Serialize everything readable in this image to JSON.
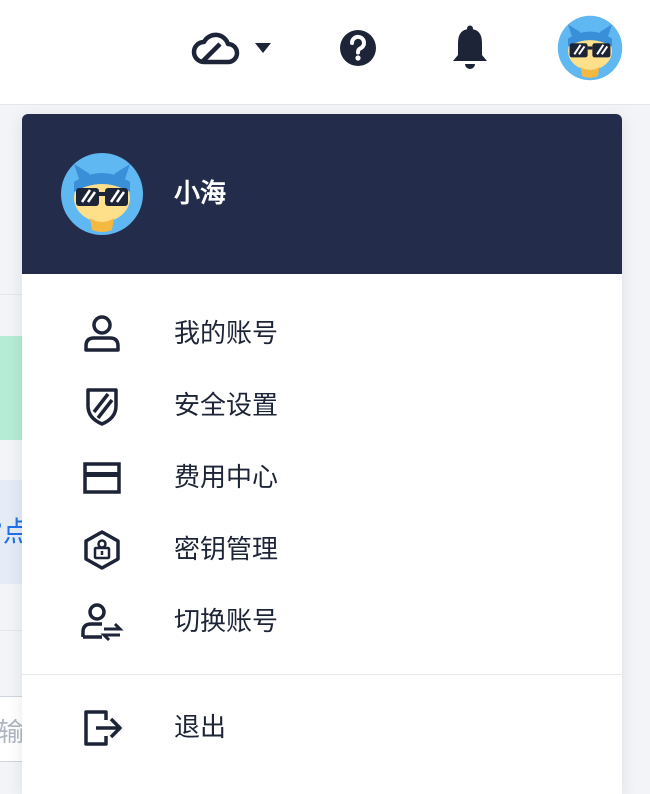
{
  "header": {
    "cloud_icon": "cloud-icon",
    "dropdown_icon": "caret-down-icon",
    "help_icon": "help-icon",
    "bell_icon": "bell-icon",
    "avatar": "avatar"
  },
  "background": {
    "partial_text": "?点",
    "partial_input": "输入"
  },
  "user_menu": {
    "username": "小海",
    "items": [
      {
        "label": "我的账号",
        "icon": "user-icon"
      },
      {
        "label": "安全设置",
        "icon": "shield-icon"
      },
      {
        "label": "费用中心",
        "icon": "card-icon"
      },
      {
        "label": "密钥管理",
        "icon": "key-icon"
      },
      {
        "label": "切换账号",
        "icon": "switch-user-icon"
      }
    ],
    "logout": {
      "label": "退出",
      "icon": "logout-icon"
    }
  },
  "colors": {
    "header_bg": "#242c4c",
    "text": "#1e2437",
    "accent": "#1f72e8"
  }
}
